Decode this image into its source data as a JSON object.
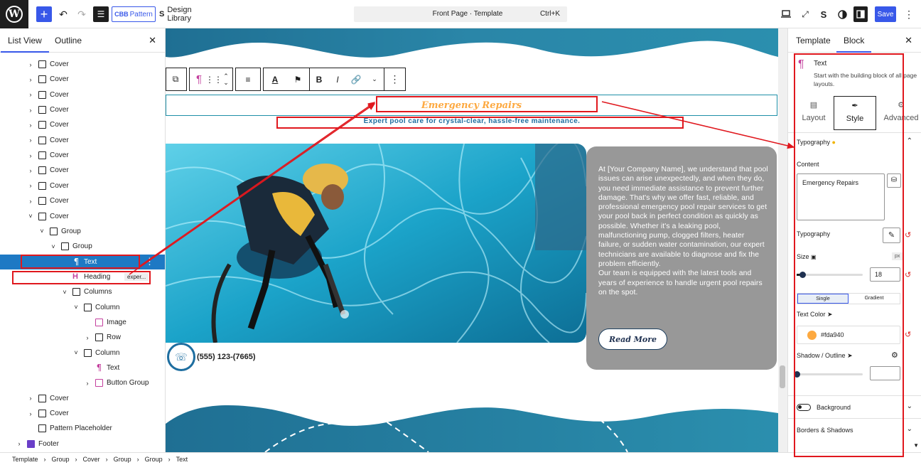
{
  "topbar": {
    "pattern_label": "Pattern",
    "design_library_label": "Design Library",
    "command_title": "Front Page · Template",
    "command_shortcut": "Ctrl+K",
    "save_label": "Save"
  },
  "left_panel": {
    "tabs": [
      "List View",
      "Outline"
    ],
    "items": [
      {
        "label": "Cover",
        "level": 1
      },
      {
        "label": "Cover",
        "level": 1
      },
      {
        "label": "Cover",
        "level": 1
      },
      {
        "label": "Cover",
        "level": 1
      },
      {
        "label": "Cover",
        "level": 1
      },
      {
        "label": "Cover",
        "level": 1
      },
      {
        "label": "Cover",
        "level": 1
      },
      {
        "label": "Cover",
        "level": 1
      },
      {
        "label": "Cover",
        "level": 1
      },
      {
        "label": "Cover",
        "level": 1
      },
      {
        "label": "Cover",
        "level": 1
      },
      {
        "label": "Group",
        "level": 2
      },
      {
        "label": "Group",
        "level": 3
      },
      {
        "label": "Text",
        "level": 4
      },
      {
        "label": "Heading",
        "level": 4,
        "badge": "exper..."
      },
      {
        "label": "Columns",
        "level": 4
      },
      {
        "label": "Column",
        "level": 5
      },
      {
        "label": "Image",
        "level": 6
      },
      {
        "label": "Row",
        "level": 6
      },
      {
        "label": "Column",
        "level": 5
      },
      {
        "label": "Text",
        "level": 6
      },
      {
        "label": "Button Group",
        "level": 6
      },
      {
        "label": "Cover",
        "level": 1
      },
      {
        "label": "Cover",
        "level": 1
      },
      {
        "label": "Pattern Placeholder",
        "level": 1
      },
      {
        "label": "Footer",
        "level": 0
      }
    ]
  },
  "canvas": {
    "text_block": "Emergency Repairs",
    "sub_heading": "Expert pool care for crystal-clear, hassle-free maintenance.",
    "card_paragraph": "At [Your Company Name], we understand that pool issues can arise unexpectedly, and when they do, you need immediate assistance to prevent further damage. That's why we offer fast, reliable, and professional emergency pool repair services to get your pool back in perfect condition as quickly as possible. Whether it's a leaking pool, malfunctioning pump, clogged filters, heater failure, or sudden water contamination, our expert technicians are available to diagnose and fix the problem efficiently.",
    "card_paragraph_2": "Our team is equipped with the latest tools and years of experience to handle urgent pool repairs on the spot.",
    "read_more": "Read More",
    "phone": "(555) 123-(7665)"
  },
  "right_panel": {
    "tabs": [
      "Template",
      "Block"
    ],
    "block_name": "Text",
    "block_desc": "Start with the building block of all page layouts.",
    "subtabs": [
      "Layout",
      "Style",
      "Advanced"
    ],
    "typography_section": "Typography",
    "content_label": "Content",
    "content_value": "Emergency Repairs",
    "typography_label": "Typography",
    "size_label": "Size",
    "size_unit": "px",
    "size_value": "18",
    "size_fraction": 0.09,
    "single_label": "Single",
    "gradient_label": "Gradient",
    "text_color_label": "Text Color",
    "text_color_value": "#fda940",
    "shadow_label": "Shadow / Outline",
    "background_label": "Background",
    "borders_label": "Borders & Shadows"
  },
  "status_bar": {
    "crumbs": [
      "Template",
      "Group",
      "Cover",
      "Group",
      "Group",
      "Text"
    ]
  },
  "colors": {
    "accent": "#3858e9",
    "selection": "#1e79c4",
    "text_color": "#fda940",
    "annotation": "#e0181e"
  }
}
